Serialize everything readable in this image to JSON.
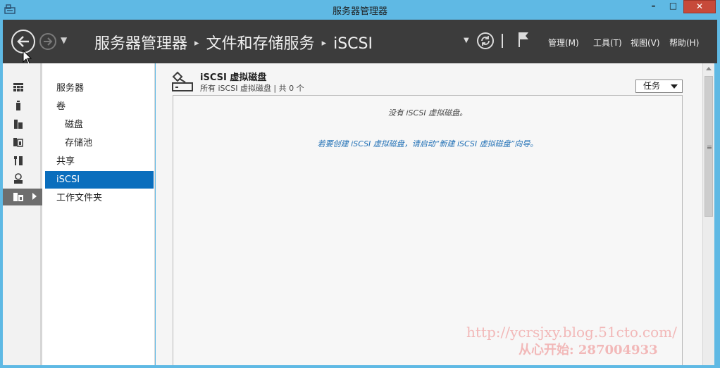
{
  "window": {
    "title": "服务器管理器",
    "controls": {
      "minimize": "–",
      "maximize": "□",
      "close": "✕"
    }
  },
  "header": {
    "breadcrumb": [
      "服务器管理器",
      "文件和存储服务",
      "iSCSI"
    ],
    "separator": "▸",
    "menu": {
      "manage": "管理(M)",
      "tools": "工具(T)",
      "view": "视图(V)",
      "help": "帮助(H)"
    }
  },
  "rail": {
    "items": [
      {
        "icon": "dashboard-icon"
      },
      {
        "icon": "local-server-icon"
      },
      {
        "icon": "all-servers-icon"
      },
      {
        "icon": "ad-cs-icon"
      },
      {
        "icon": "tools-icon"
      },
      {
        "icon": "iis-icon"
      },
      {
        "icon": "file-storage-icon",
        "active": true
      }
    ]
  },
  "subnav": {
    "items": [
      {
        "label": "服务器",
        "child": false,
        "active": false
      },
      {
        "label": "卷",
        "child": false,
        "active": false
      },
      {
        "label": "磁盘",
        "child": true,
        "active": false
      },
      {
        "label": "存储池",
        "child": true,
        "active": false
      },
      {
        "label": "共享",
        "child": false,
        "active": false
      },
      {
        "label": "iSCSI",
        "child": false,
        "active": true
      },
      {
        "label": "工作文件夹",
        "child": false,
        "active": false
      }
    ]
  },
  "tile": {
    "title": "iSCSI 虚拟磁盘",
    "subtitle": "所有 iSCSI 虚拟磁盘 | 共 0 个",
    "tasks_label": "任务",
    "empty_message": "没有 iSCSI 虚拟磁盘。",
    "hint_message": "若要创建 iSCSI 虚拟磁盘，请启动“新建 iSCSI 虚拟磁盘”向导。"
  },
  "watermark": {
    "url": "http://ycrsjxy.blog.51cto.com/",
    "line2": "从心开始: 287004933"
  },
  "colors": {
    "titlebar": "#5fb9e4",
    "header": "#3c3c3c",
    "accent": "#0a6ebd",
    "hint_text": "#1f6fb5"
  }
}
